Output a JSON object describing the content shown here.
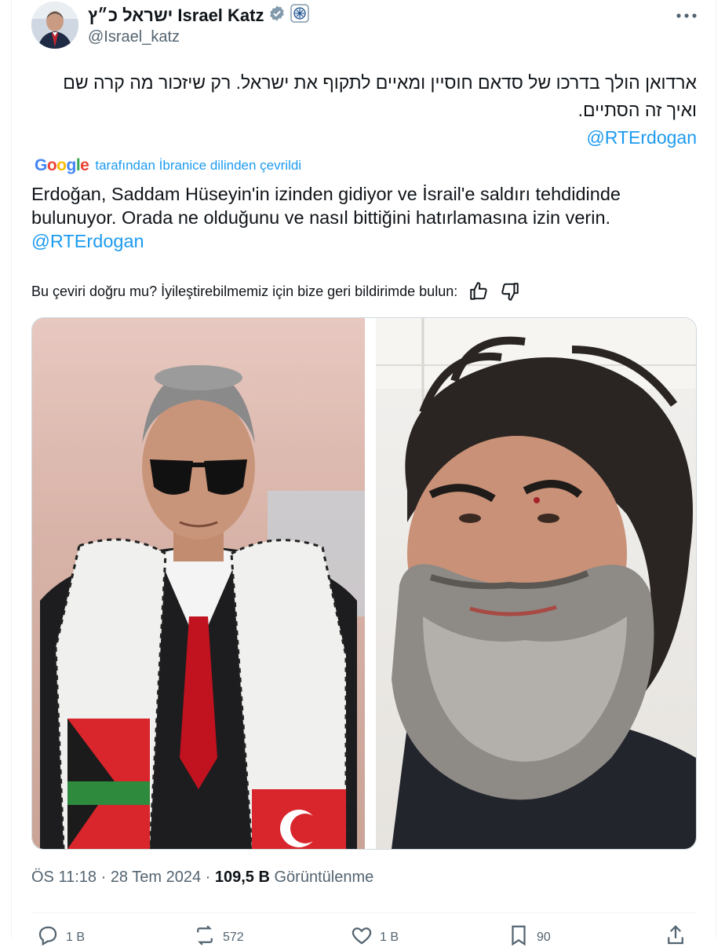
{
  "author": {
    "display_name": "ישראל כ״ץ Israel Katz",
    "handle": "@Israel_katz",
    "verified_badge": "verified-badge-icon",
    "affiliate_badge": "government-emblem-icon"
  },
  "tweet": {
    "text_hebrew": "ארדואן הולך בדרכו של סדאם חוסיין ומאיים לתקוף את ישראל. רק שיזכור מה קרה שם ואיך זה הסתיים.",
    "mention_hebrew": "@RTErdogan",
    "translation": {
      "google_logo": "Google",
      "translated_by": "tarafından İbranice dilinden çevrildi",
      "text": "Erdoğan, Saddam Hüseyin'in izinden gidiyor ve İsrail'e saldırı tehdidinde bulunuyor. Orada ne olduğunu ve nasıl bittiğini hatırlamasına izin verin.",
      "mention": "@RTErdogan",
      "feedback_question": "Bu çeviri doğru mu? İyileştirebilmemiz için bize geri bildirimde bulun:"
    }
  },
  "meta": {
    "time": "ÖS 11:18",
    "date": "28 Tem 2024",
    "views_count": "109,5 B",
    "views_label": "Görüntülenme"
  },
  "actions": {
    "reply_count": "1 B",
    "retweet_count": "572",
    "like_count": "1 B",
    "bookmark_count": "90"
  },
  "colors": {
    "accent": "#1d9bf0",
    "secondary_text": "#536471",
    "primary_text": "#0f1419"
  }
}
